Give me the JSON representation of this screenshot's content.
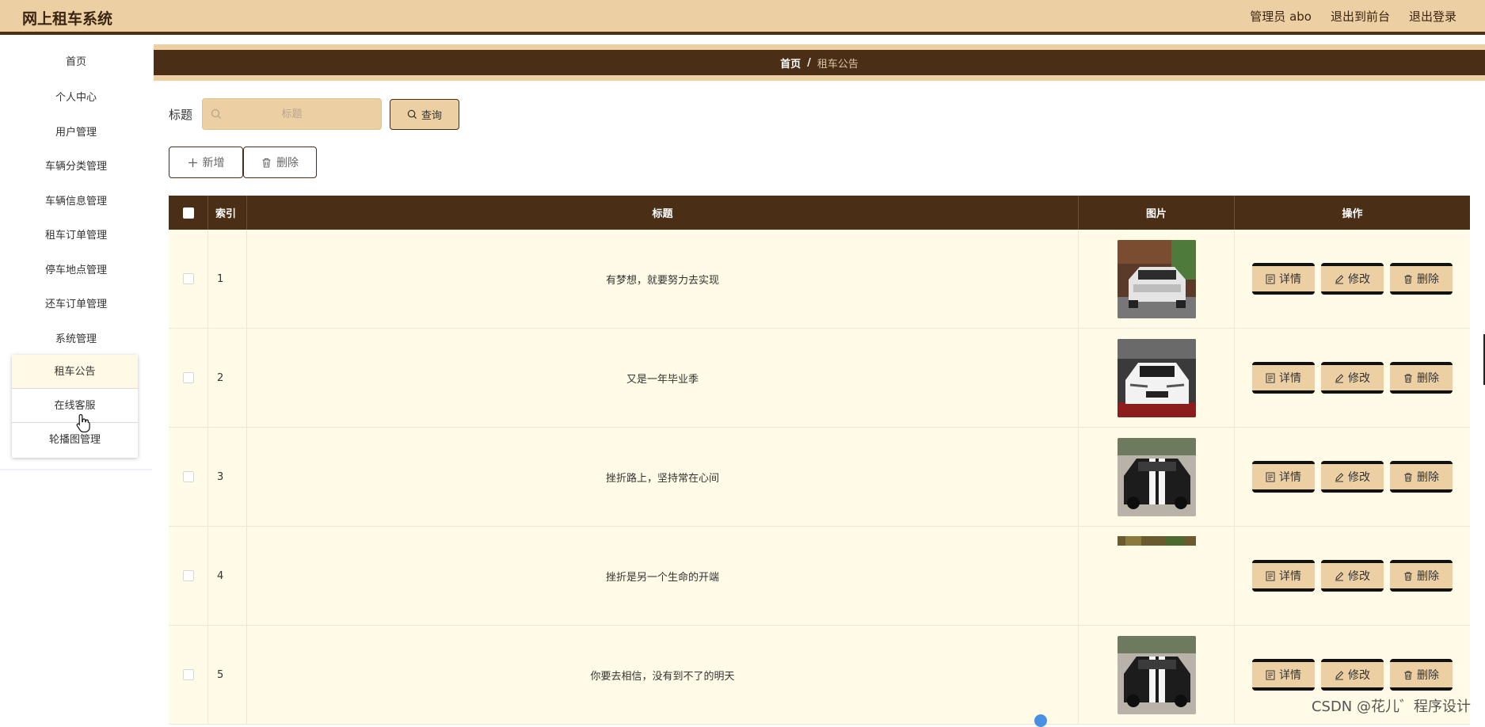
{
  "header": {
    "app_title": "网上租车系统",
    "admin_label": "管理员 abo",
    "goto_frontend": "退出到前台",
    "logout": "退出登录"
  },
  "sidebar": {
    "items": [
      "首页",
      "个人中心",
      "用户管理",
      "车辆分类管理",
      "车辆信息管理",
      "租车订单管理",
      "停车地点管理",
      "还车订单管理",
      "系统管理"
    ],
    "submenu": [
      "租车公告",
      "在线客服",
      "轮播图管理"
    ]
  },
  "breadcrumb": {
    "home": "首页",
    "separator": "/",
    "current": "租车公告"
  },
  "search": {
    "label": "标题",
    "placeholder": "标题",
    "query_button": "查询"
  },
  "actions": {
    "add": "新增",
    "delete": "删除"
  },
  "table": {
    "columns": [
      "索引",
      "标题",
      "图片",
      "操作"
    ],
    "rows": [
      {
        "index": "1",
        "title": "有梦想，就要努力去实现"
      },
      {
        "index": "2",
        "title": "又是一年毕业季"
      },
      {
        "index": "3",
        "title": "挫折路上，坚持常在心间"
      },
      {
        "index": "4",
        "title": "挫折是另一个生命的开端"
      },
      {
        "index": "5",
        "title": "你要去相信，没有到不了的明天"
      }
    ],
    "row_buttons": {
      "detail": "详情",
      "edit": "修改",
      "delete": "删除"
    }
  },
  "watermark": "CSDN @花儿゛程序设计",
  "colors": {
    "accent": "#ecd0a4",
    "dark_brown": "#4a2e16",
    "row_bg": "#fffbe6"
  }
}
